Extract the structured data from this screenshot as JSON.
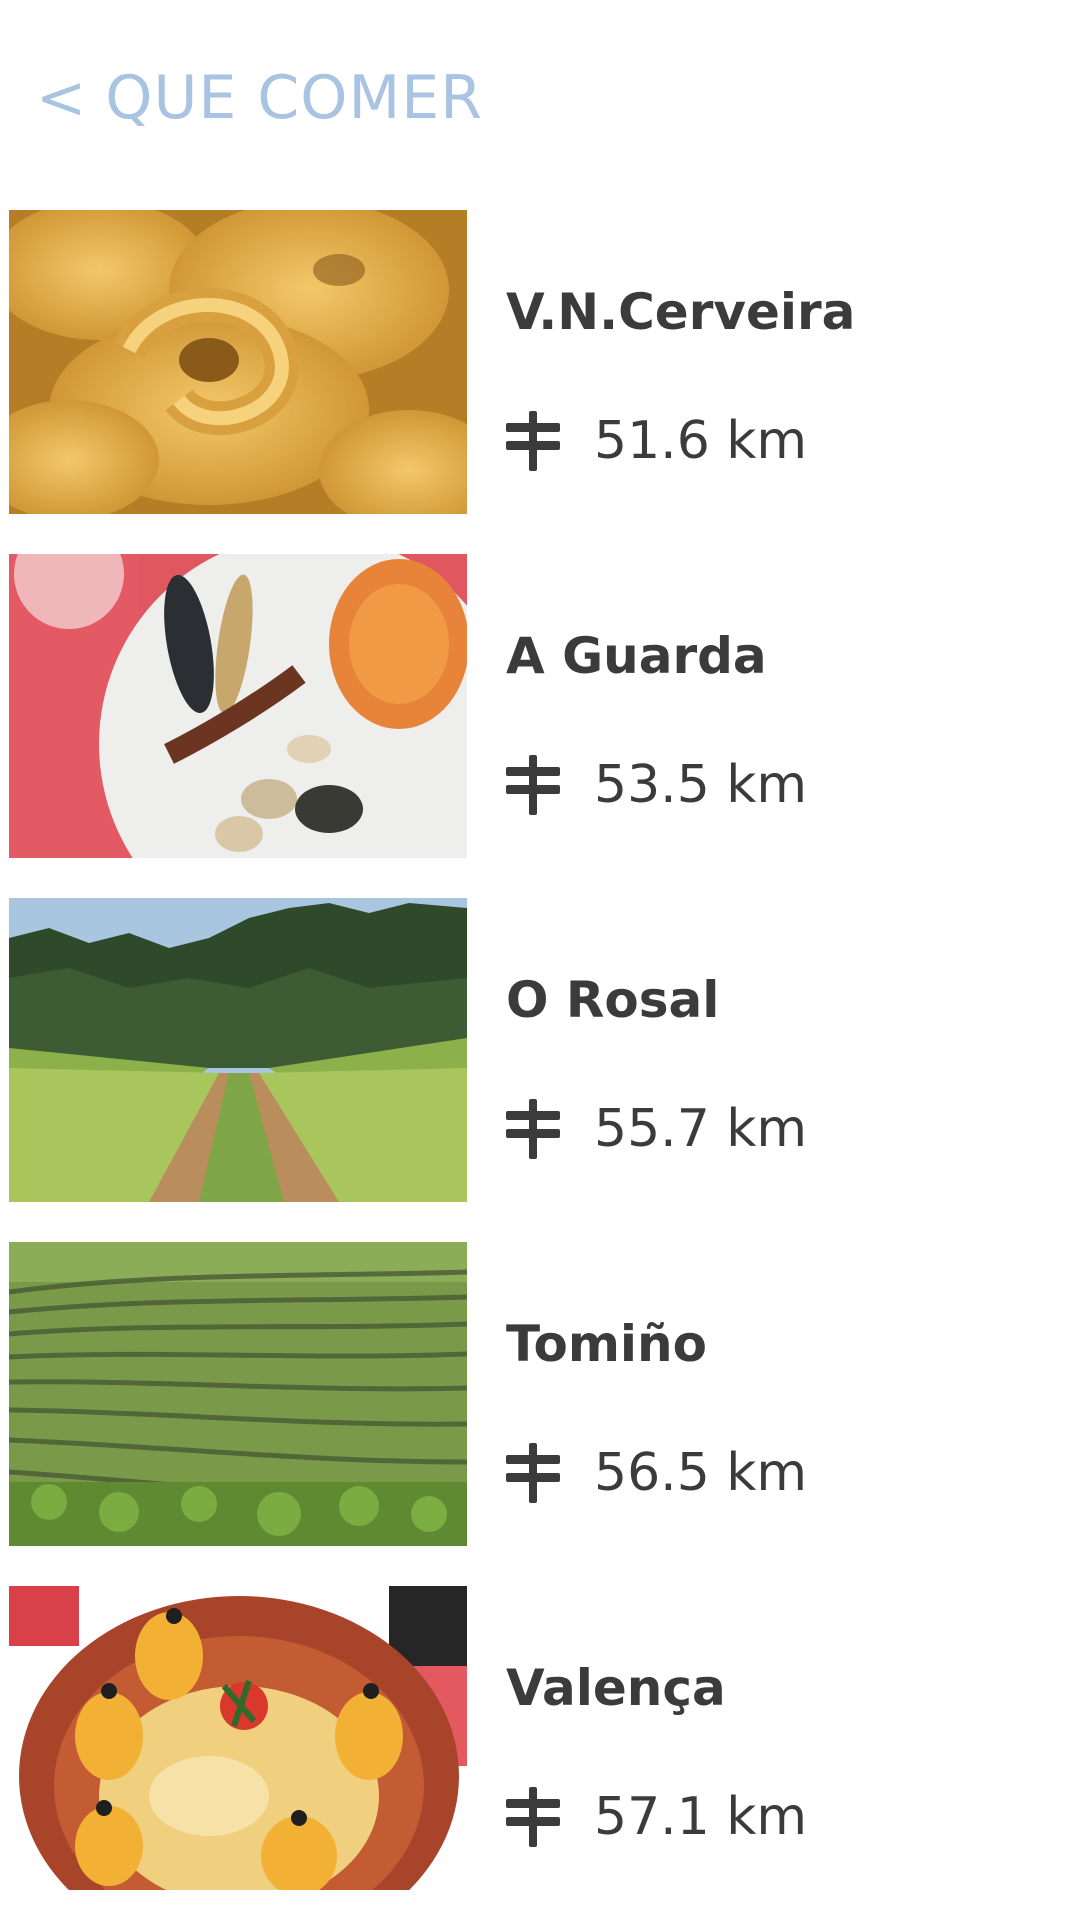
{
  "header": {
    "back_chevron": "<",
    "title": "QUE COMER",
    "accent_color": "#a9c3e3"
  },
  "items": [
    {
      "name": "V.N.Cerveira",
      "distance": "51.6 km",
      "image": "cookies-food-photo"
    },
    {
      "name": "A Guarda",
      "distance": "53.5 km",
      "image": "seafood-platter-photo"
    },
    {
      "name": "O Rosal",
      "distance": "55.7 km",
      "image": "vineyard-path-photo"
    },
    {
      "name": "Tomiño",
      "distance": "56.5 km",
      "image": "vineyard-rows-photo"
    },
    {
      "name": "Valença",
      "distance": "57.1 km",
      "image": "stuffed-dish-clay-bowl-photo"
    }
  ],
  "icons": {
    "distance": "signpost-icon"
  },
  "colors": {
    "text": "#3b3b3b",
    "background": "#ffffff"
  }
}
